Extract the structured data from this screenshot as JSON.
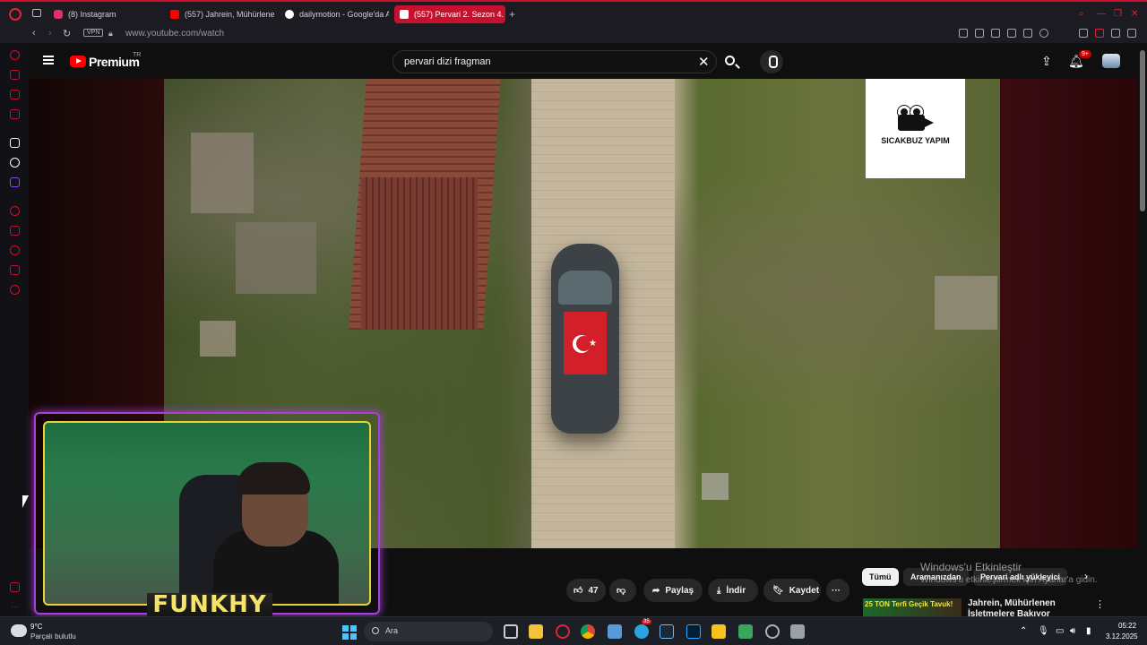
{
  "browser": {
    "tabs": [
      {
        "label": "(8) Instagram",
        "color": "#e1306c"
      },
      {
        "label": "(557) Jahrein, Mühürlene",
        "color": "#ff0000"
      },
      {
        "label": "dailymotion - Google'da A",
        "color": "#4285f4"
      },
      {
        "label": "(557) Pervari 2. Sezon 4.",
        "color": "#ff0000",
        "active": true
      }
    ],
    "url": "www.youtube.com/watch",
    "vpn_label": "VPN"
  },
  "youtube": {
    "logo_word": "Premium",
    "logo_region": "TR",
    "search_value": "pervari dizi fragman",
    "notification_count": "9+",
    "video_watermark": "SICAKBUZ YAPIM",
    "actions": {
      "likes": "47",
      "share": "Paylaş",
      "download": "İndir",
      "save": "Kaydet"
    },
    "chips": [
      "Tümü",
      "Aramanızdan",
      "Pervari adlı yükleyici"
    ],
    "recommended": {
      "thumb_text": "25 TON Terfi Geçik Tavuk!",
      "title": "Jahrein, Mühürlenen İşletmelere Bakıyor"
    }
  },
  "windows_activation": {
    "title": "Windows'u Etkinleştir",
    "subtitle": "Windows'u etkinleştirmek için Ayarlar'a gidin."
  },
  "webcam": {
    "name": "FUNKHY"
  },
  "taskbar": {
    "weather_temp": "9°C",
    "weather_desc": "Parçalı bulutlu",
    "search_placeholder": "Ara",
    "telegram_badge": "35",
    "time": "05:22",
    "date": "3.12.2025"
  },
  "colors": {
    "opera_red": "#c8102e",
    "youtube_red": "#ff0000",
    "webcam_outer": "#a640d8",
    "webcam_inner": "#e8d23a",
    "name_text": "#f6e36a"
  }
}
